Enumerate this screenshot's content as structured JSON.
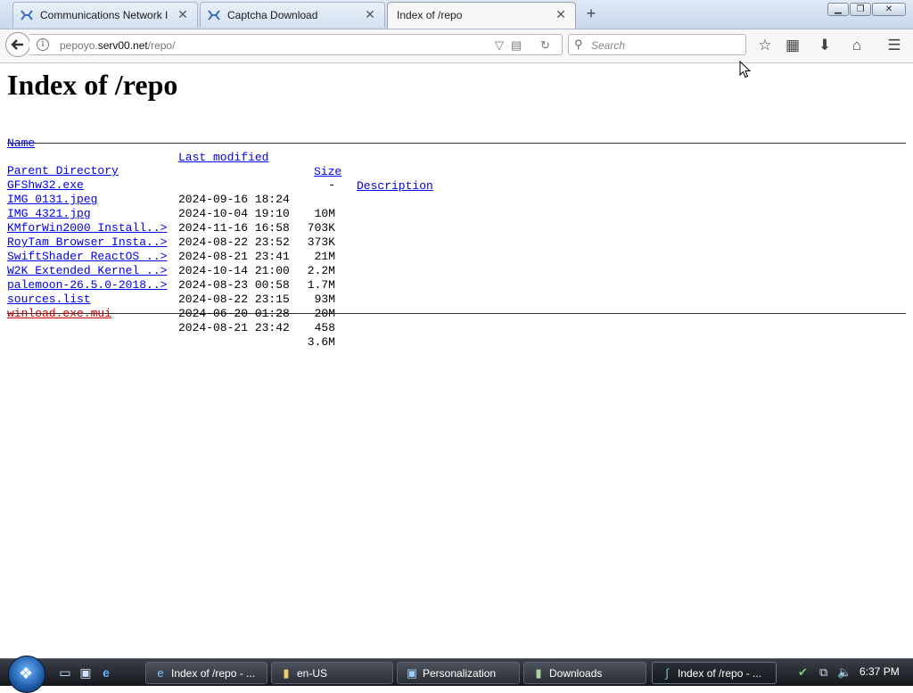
{
  "browser": {
    "tabs": [
      {
        "title": "Communications Network I",
        "icon": "glyph-tab-icon"
      },
      {
        "title": "Captcha Download",
        "icon": "glyph-tab-icon"
      },
      {
        "title": "Index of /repo",
        "icon": "none"
      }
    ],
    "new_tab_label": "+",
    "url_prefix": "pepoyo.",
    "url_host": "serv00.net",
    "url_path": "/repo/",
    "search_placeholder": "Search"
  },
  "page": {
    "title": "Index of /repo",
    "headers": {
      "name": "Name",
      "modified": "Last modified",
      "size": "Size",
      "description": "Description"
    },
    "parent": {
      "name": "Parent Directory",
      "size": "-"
    },
    "files": [
      {
        "name": "GFShw32.exe",
        "modified": "2024-09-16 18:24",
        "size": "10M"
      },
      {
        "name": "IMG_0131.jpeg",
        "modified": "2024-10-04 19:10",
        "size": "703K"
      },
      {
        "name": "IMG_4321.jpg",
        "modified": "2024-11-16 16:58",
        "size": "373K"
      },
      {
        "name": "KMforWin2000_Install..>",
        "modified": "2024-08-22 23:52",
        "size": "21M"
      },
      {
        "name": "RoyTam_Browser_Insta..>",
        "modified": "2024-08-21 23:41",
        "size": "2.2M"
      },
      {
        "name": "SwiftShader_ReactOS_..>",
        "modified": "2024-10-14 21:00",
        "size": "1.7M"
      },
      {
        "name": "W2K_Extended_Kernel_..>",
        "modified": "2024-08-23 00:58",
        "size": "93M"
      },
      {
        "name": "palemoon-26.5.0-2018..>",
        "modified": "2024-08-22 23:15",
        "size": "20M"
      },
      {
        "name": "sources.list",
        "modified": "2024-06-20 01:28",
        "size": "458"
      },
      {
        "name": "winload.exe.mui",
        "modified": "2024-08-21 23:42",
        "size": "3.6M"
      }
    ]
  },
  "taskbar": {
    "tasks": [
      {
        "label": "Index of /repo - ..."
      },
      {
        "label": "en-US"
      },
      {
        "label": "Personalization"
      },
      {
        "label": "Downloads"
      },
      {
        "label": "Index of /repo - ..."
      }
    ],
    "clock": "6:37 PM"
  },
  "colors": {
    "link": "#0000ee",
    "visited_link": "#cc0000",
    "taskbar": "#1c2027"
  }
}
